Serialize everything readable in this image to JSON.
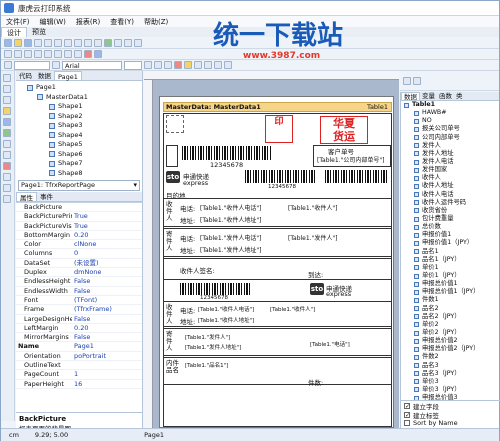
{
  "window": {
    "title": "康虎云打印系统"
  },
  "menu": [
    "文件(F)",
    "编辑(W)",
    "报表(R)",
    "查看(Y)",
    "帮助(Z)"
  ],
  "top_tabs": [
    "设计",
    "预览"
  ],
  "font": {
    "name": "Arial"
  },
  "left_tabs": [
    "代码",
    "数据",
    "Page1"
  ],
  "tree": {
    "page": "Page1",
    "band": "MasterData1",
    "shapes": [
      "Shape1",
      "Shape2",
      "Shape3",
      "Shape4",
      "Shape5",
      "Shape6",
      "Shape7",
      "Shape8"
    ]
  },
  "object_combo": "Page1: TfrxReportPage",
  "prop_tabs": [
    "属性",
    "事件"
  ],
  "properties": [
    {
      "name": "BackPicture",
      "value": ""
    },
    {
      "name": "BackPicturePrintable",
      "value": "True"
    },
    {
      "name": "BackPictureVisible",
      "value": "True"
    },
    {
      "name": "BottomMargin",
      "value": "0.20"
    },
    {
      "name": "Color",
      "value": "clNone"
    },
    {
      "name": "Columns",
      "value": "0"
    },
    {
      "name": "DataSet",
      "value": "(未设置)"
    },
    {
      "name": "Duplex",
      "value": "dmNone"
    },
    {
      "name": "EndlessHeight",
      "value": "False"
    },
    {
      "name": "EndlessWidth",
      "value": "False"
    },
    {
      "name": "Font",
      "value": "(TFont)"
    },
    {
      "name": "Frame",
      "value": "(TfrxFrame)"
    },
    {
      "name": "LargeDesignHeight",
      "value": "False"
    },
    {
      "name": "LeftMargin",
      "value": "0.20"
    },
    {
      "name": "MirrorMargins",
      "value": "False"
    },
    {
      "name": "Name",
      "value": "Page1"
    },
    {
      "name": "Orientation",
      "value": "poPortrait"
    },
    {
      "name": "OutlineText",
      "value": ""
    },
    {
      "name": "PageCount",
      "value": "1"
    },
    {
      "name": "PaperHeight",
      "value": "16"
    }
  ],
  "prop_desc": {
    "title": "BackPicture",
    "text": "报表页面的背景图"
  },
  "report": {
    "band_name": "MasterData: MasterData1",
    "band_table": "Table1",
    "stamp_top": "华夏",
    "stamp_bottom": "货运",
    "barcode_num1": "12345678",
    "client_code_label": "客户单号",
    "client_code_field": "[Table1.\"公司内部单号\"]",
    "sto_text": "申通快递",
    "sto_sub": "express",
    "barcode_num2": "12345678",
    "dest_label": "目的地",
    "recv_vertical": "收件人",
    "tel_label": "电话:",
    "recv_tel": "[Table1.\"收件人电话\"]",
    "recv_name": "[Table1.\"收件人\"]",
    "addr_label": "地址:",
    "recv_addr": "[Table1.\"收件人地址\"]",
    "send_vertical": "寄件人",
    "send_tel": "[Table1.\"发件人电话\"]",
    "send_name": "[Table1.\"发件人\"]",
    "send_addr": "[Table1.\"发件人地址\"]",
    "sign_label": "收件人签名:",
    "arrive_label": "到达:",
    "barcode_num3": "12345678",
    "recv_tel2": "[Table1.\"收件人电话\"]",
    "recv_name2": "[Table1.\"收件人\"]",
    "recv_addr2": "[Table1.\"收件人地址\"]",
    "send_name2": "[Table1.\"发件人\"]",
    "send_addr2": "[Table1.\"发件人地址\"]",
    "send_misc2": "[Table1.\"电话\"]",
    "goods_label": "内件品名",
    "goods_field": "[Table1.\"品名1\"]",
    "piece_label": "件数:"
  },
  "right_tabs": [
    "数据",
    "变量",
    "函数",
    "类"
  ],
  "fields_root": "Table1",
  "fields": [
    "HAWB#",
    "NO",
    "报关公司单号",
    "公司内部单号",
    "发件人",
    "发件人地址",
    "发件人电话",
    "发件国家",
    "收件人",
    "收件人地址",
    "收件人电话",
    "收件人运件号码",
    "收货省份",
    "包计费重量",
    "总价数",
    "申报价值1",
    "申报价值1（JPY）",
    "品名1",
    "品名1（JPY）",
    "单价1",
    "单价1（JPY）",
    "申报总价值1",
    "申报总价值1（JPY）",
    "件数1",
    "品名2",
    "品名2（JPY）",
    "单价2",
    "单价2（JPY）",
    "申报总价值2",
    "申报总价值2（JPY）",
    "件数2",
    "品名3",
    "品名3（JPY）",
    "单价3",
    "单价3（JPY）",
    "申报总价值3"
  ],
  "right_options": [
    "建立字段",
    "建立标签",
    "Sort by Name"
  ],
  "status": {
    "unit": "cm",
    "coords": "9.29; 5.00",
    "page": "Page1"
  },
  "watermark": {
    "brand": "统一下载站",
    "site": "www.3987.com"
  }
}
